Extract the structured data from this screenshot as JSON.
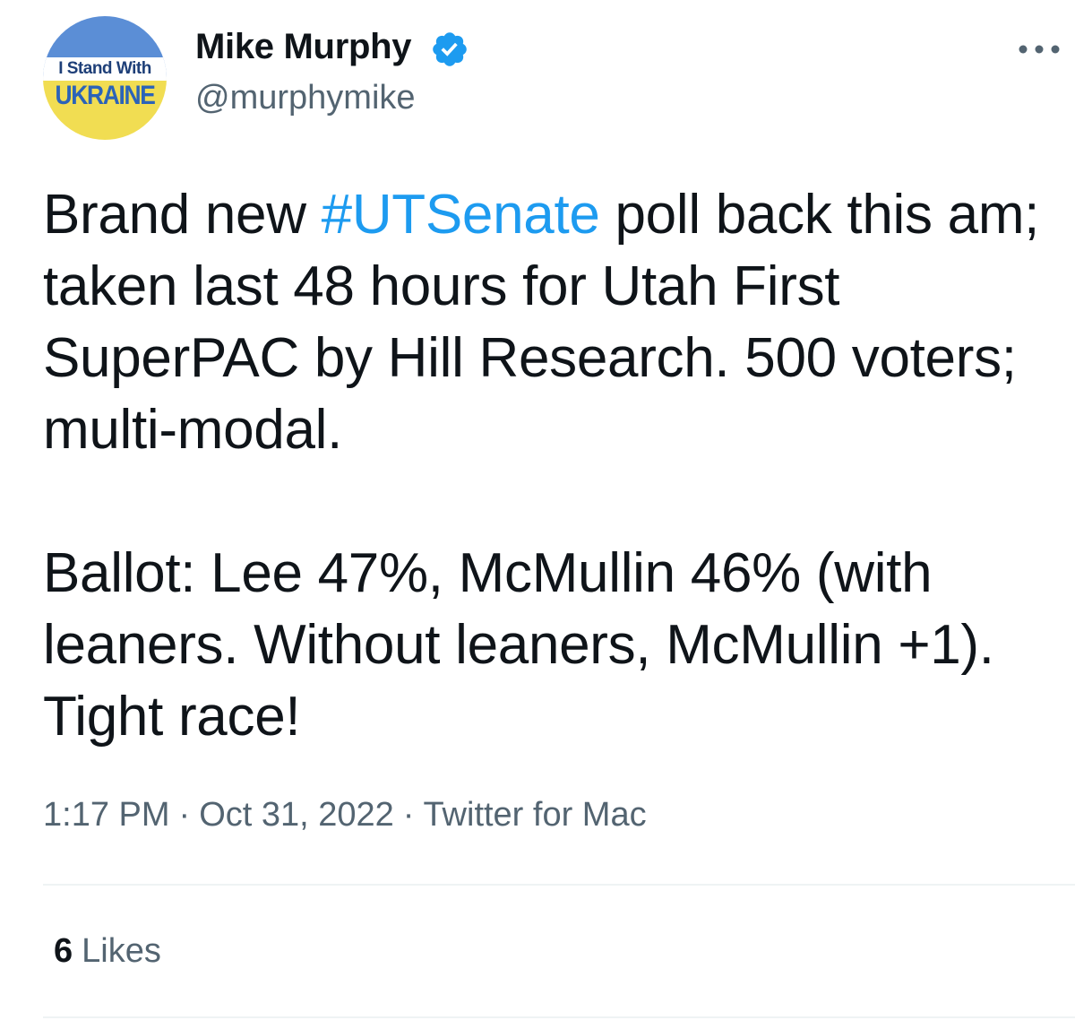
{
  "author": {
    "display_name": "Mike Murphy",
    "handle": "@murphymike",
    "verified": true,
    "avatar": {
      "line1": "I Stand With",
      "line2": "UKRAINE",
      "colors": {
        "top": "#5b8ed6",
        "bottom": "#f1dd52"
      }
    }
  },
  "tweet": {
    "p1_before": "Brand new ",
    "hashtag": "#UTSenate",
    "p1_after": " poll back this am; taken last 48 hours for Utah First SuperPAC by Hill Research.  500 voters; multi-modal.",
    "p2": "Ballot: Lee 47%, McMullin 46% (with leaners. Without leaners, McMullin +1).  Tight race!"
  },
  "meta": {
    "time": "1:17 PM",
    "separator": "·",
    "date": "Oct 31, 2022",
    "source": "Twitter for Mac"
  },
  "engagement": {
    "likes_count": "6",
    "likes_label": "Likes"
  },
  "icons": {
    "verified": "verified-badge-icon",
    "more": "more-options-icon"
  },
  "colors": {
    "link": "#1d9bf0",
    "secondary": "#536471",
    "text": "#0f1419"
  }
}
